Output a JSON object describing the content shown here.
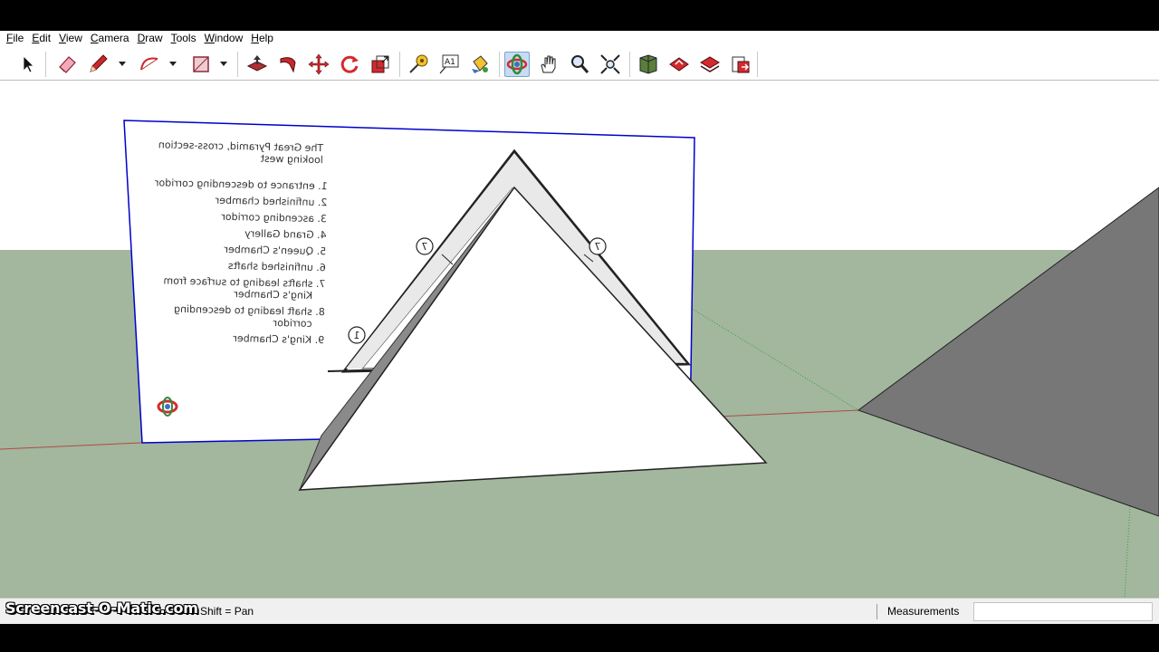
{
  "menu": {
    "items": [
      {
        "label": "File"
      },
      {
        "label": "Edit"
      },
      {
        "label": "View"
      },
      {
        "label": "Camera"
      },
      {
        "label": "Draw"
      },
      {
        "label": "Tools"
      },
      {
        "label": "Window"
      },
      {
        "label": "Help"
      }
    ]
  },
  "toolbar": {
    "tools": [
      {
        "name": "select-tool",
        "icon": "arrow-cursor-icon"
      },
      {
        "name": "eraser-tool",
        "icon": "eraser-icon"
      },
      {
        "name": "pencil-tool",
        "icon": "pencil-icon"
      },
      {
        "name": "arc-tool",
        "icon": "arc-icon"
      },
      {
        "name": "rectangle-tool",
        "icon": "rectangle-icon"
      },
      {
        "name": "push-pull-tool",
        "icon": "push-pull-icon"
      },
      {
        "name": "follow-me-tool",
        "icon": "follow-me-icon"
      },
      {
        "name": "move-tool",
        "icon": "move-arrows-icon"
      },
      {
        "name": "rotate-tool",
        "icon": "rotate-icon"
      },
      {
        "name": "scale-tool",
        "icon": "scale-icon"
      },
      {
        "name": "tape-measure-tool",
        "icon": "tape-measure-icon"
      },
      {
        "name": "text-tool",
        "icon": "text-a1-icon"
      },
      {
        "name": "paint-bucket-tool",
        "icon": "paint-bucket-icon"
      },
      {
        "name": "orbit-tool",
        "icon": "orbit-icon",
        "active": true
      },
      {
        "name": "pan-tool",
        "icon": "hand-icon"
      },
      {
        "name": "zoom-tool",
        "icon": "magnifier-icon"
      },
      {
        "name": "zoom-extents-tool",
        "icon": "zoom-extents-icon"
      },
      {
        "name": "3d-warehouse-tool",
        "icon": "warehouse-icon"
      },
      {
        "name": "share-model-tool",
        "icon": "share-model-icon"
      },
      {
        "name": "get-models-tool",
        "icon": "get-models-icon"
      },
      {
        "name": "send-to-layout-tool",
        "icon": "layout-icon"
      }
    ]
  },
  "scene": {
    "legend_title": "The Great Pyramid, cross-section\nlooking west",
    "legend_items": [
      "1. entrance to descending corridor",
      "2. unfinished chamber",
      "3. ascending corridor",
      "4. Grand Gallery",
      "5. Queen's Chamber",
      "6. unfinished shafts",
      "7. shafts leading to surface from\n    King's Chamber",
      "8. shaft leading to descending\n    corridor",
      "9. King's Chamber"
    ],
    "callouts": [
      "7",
      "7",
      "1"
    ],
    "colors": {
      "sky": "#ffffff",
      "ground": "#a2b79d",
      "face_white": "#ffffff",
      "face_gray": "#8a8a8a",
      "selection_blue": "#0000cc",
      "axis_red": "#b04a4a",
      "axis_green": "#3c9a3c"
    }
  },
  "status": {
    "hint": "Shift = Pan",
    "measurements_label": "Measurements",
    "measurements_value": ""
  },
  "watermark": "Screencast-O-Matic.com"
}
